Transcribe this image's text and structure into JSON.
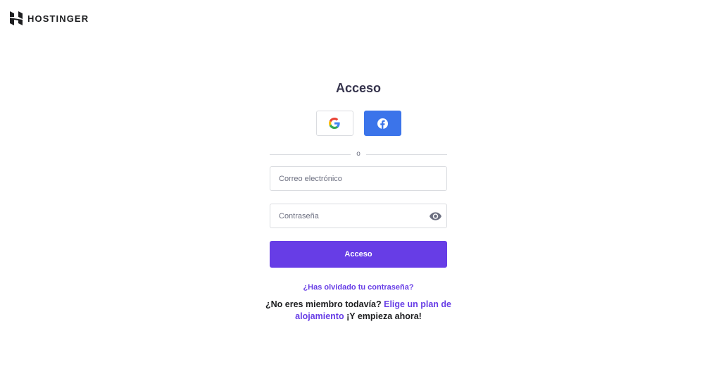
{
  "brand": {
    "name": "HOSTINGER",
    "logo_icon": "hostinger-logo-icon"
  },
  "login": {
    "title": "Acceso",
    "social": {
      "google_icon": "google-icon",
      "facebook_icon": "facebook-icon"
    },
    "divider_text": "o",
    "email": {
      "placeholder": "Correo electrónico",
      "value": ""
    },
    "password": {
      "placeholder": "Contraseña",
      "value": "",
      "toggle_icon": "eye-icon"
    },
    "submit_label": "Acceso",
    "forgot_link": "¿Has olvidado tu contraseña?"
  },
  "signup": {
    "prefix": "¿No eres miembro todavía?",
    "link_text": "Elige un plan de alojamiento",
    "suffix": "¡Y empieza ahora!"
  },
  "colors": {
    "primary": "#673de6",
    "facebook": "#3b74ea",
    "text": "#36344d",
    "border": "#dadce0"
  }
}
